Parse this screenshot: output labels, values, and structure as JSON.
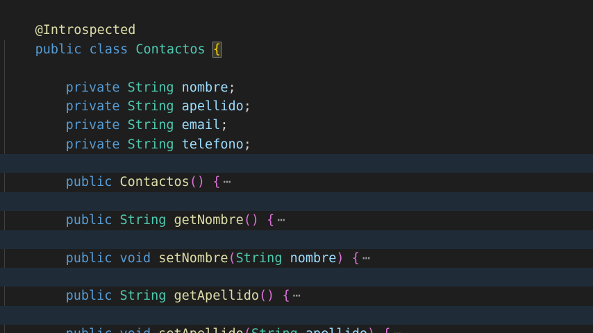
{
  "colors": {
    "background": "#1e1e1e",
    "keyword": "#569cd6",
    "type": "#4ec9b0",
    "field": "#9cdcfe",
    "method": "#dcdcaa",
    "annotation": "#dcdcaa",
    "punctuation": "#d4d4d4",
    "brace_outer": "#ffd700",
    "paren": "#da70d6",
    "paren_inner": "#179fff",
    "folded_bg": "#1f2c38"
  },
  "code": {
    "annotation": "@Introspected",
    "class_decl": {
      "kw1": "public",
      "kw2": "class",
      "name": "Contactos",
      "brace": "{"
    },
    "fields": [
      {
        "modifier": "private",
        "type": "String",
        "name": "nombre",
        "end": ";"
      },
      {
        "modifier": "private",
        "type": "String",
        "name": "apellido",
        "end": ";"
      },
      {
        "modifier": "private",
        "type": "String",
        "name": "email",
        "end": ";"
      },
      {
        "modifier": "private",
        "type": "String",
        "name": "telefono",
        "end": ";"
      }
    ],
    "methods": [
      {
        "modifier": "public",
        "ret": "",
        "name": "Contactos",
        "open": "(",
        "ptype": "",
        "pname": "",
        "close": ")",
        "brace": "{",
        "ellipsis": "⋯"
      },
      {
        "modifier": "public",
        "ret": "String",
        "name": "getNombre",
        "open": "(",
        "ptype": "",
        "pname": "",
        "close": ")",
        "brace": "{",
        "ellipsis": "⋯"
      },
      {
        "modifier": "public",
        "ret": "void",
        "name": "setNombre",
        "open": "(",
        "ptype": "String",
        "pname": "nombre",
        "close": ")",
        "brace": "{",
        "ellipsis": "⋯"
      },
      {
        "modifier": "public",
        "ret": "String",
        "name": "getApellido",
        "open": "(",
        "ptype": "",
        "pname": "",
        "close": ")",
        "brace": "{",
        "ellipsis": "⋯"
      },
      {
        "modifier": "public",
        "ret": "void",
        "name": "setApellido",
        "open": "(",
        "ptype": "String",
        "pname": "apellido",
        "close": ")",
        "brace": "{",
        "ellipsis": "⋯"
      }
    ]
  }
}
